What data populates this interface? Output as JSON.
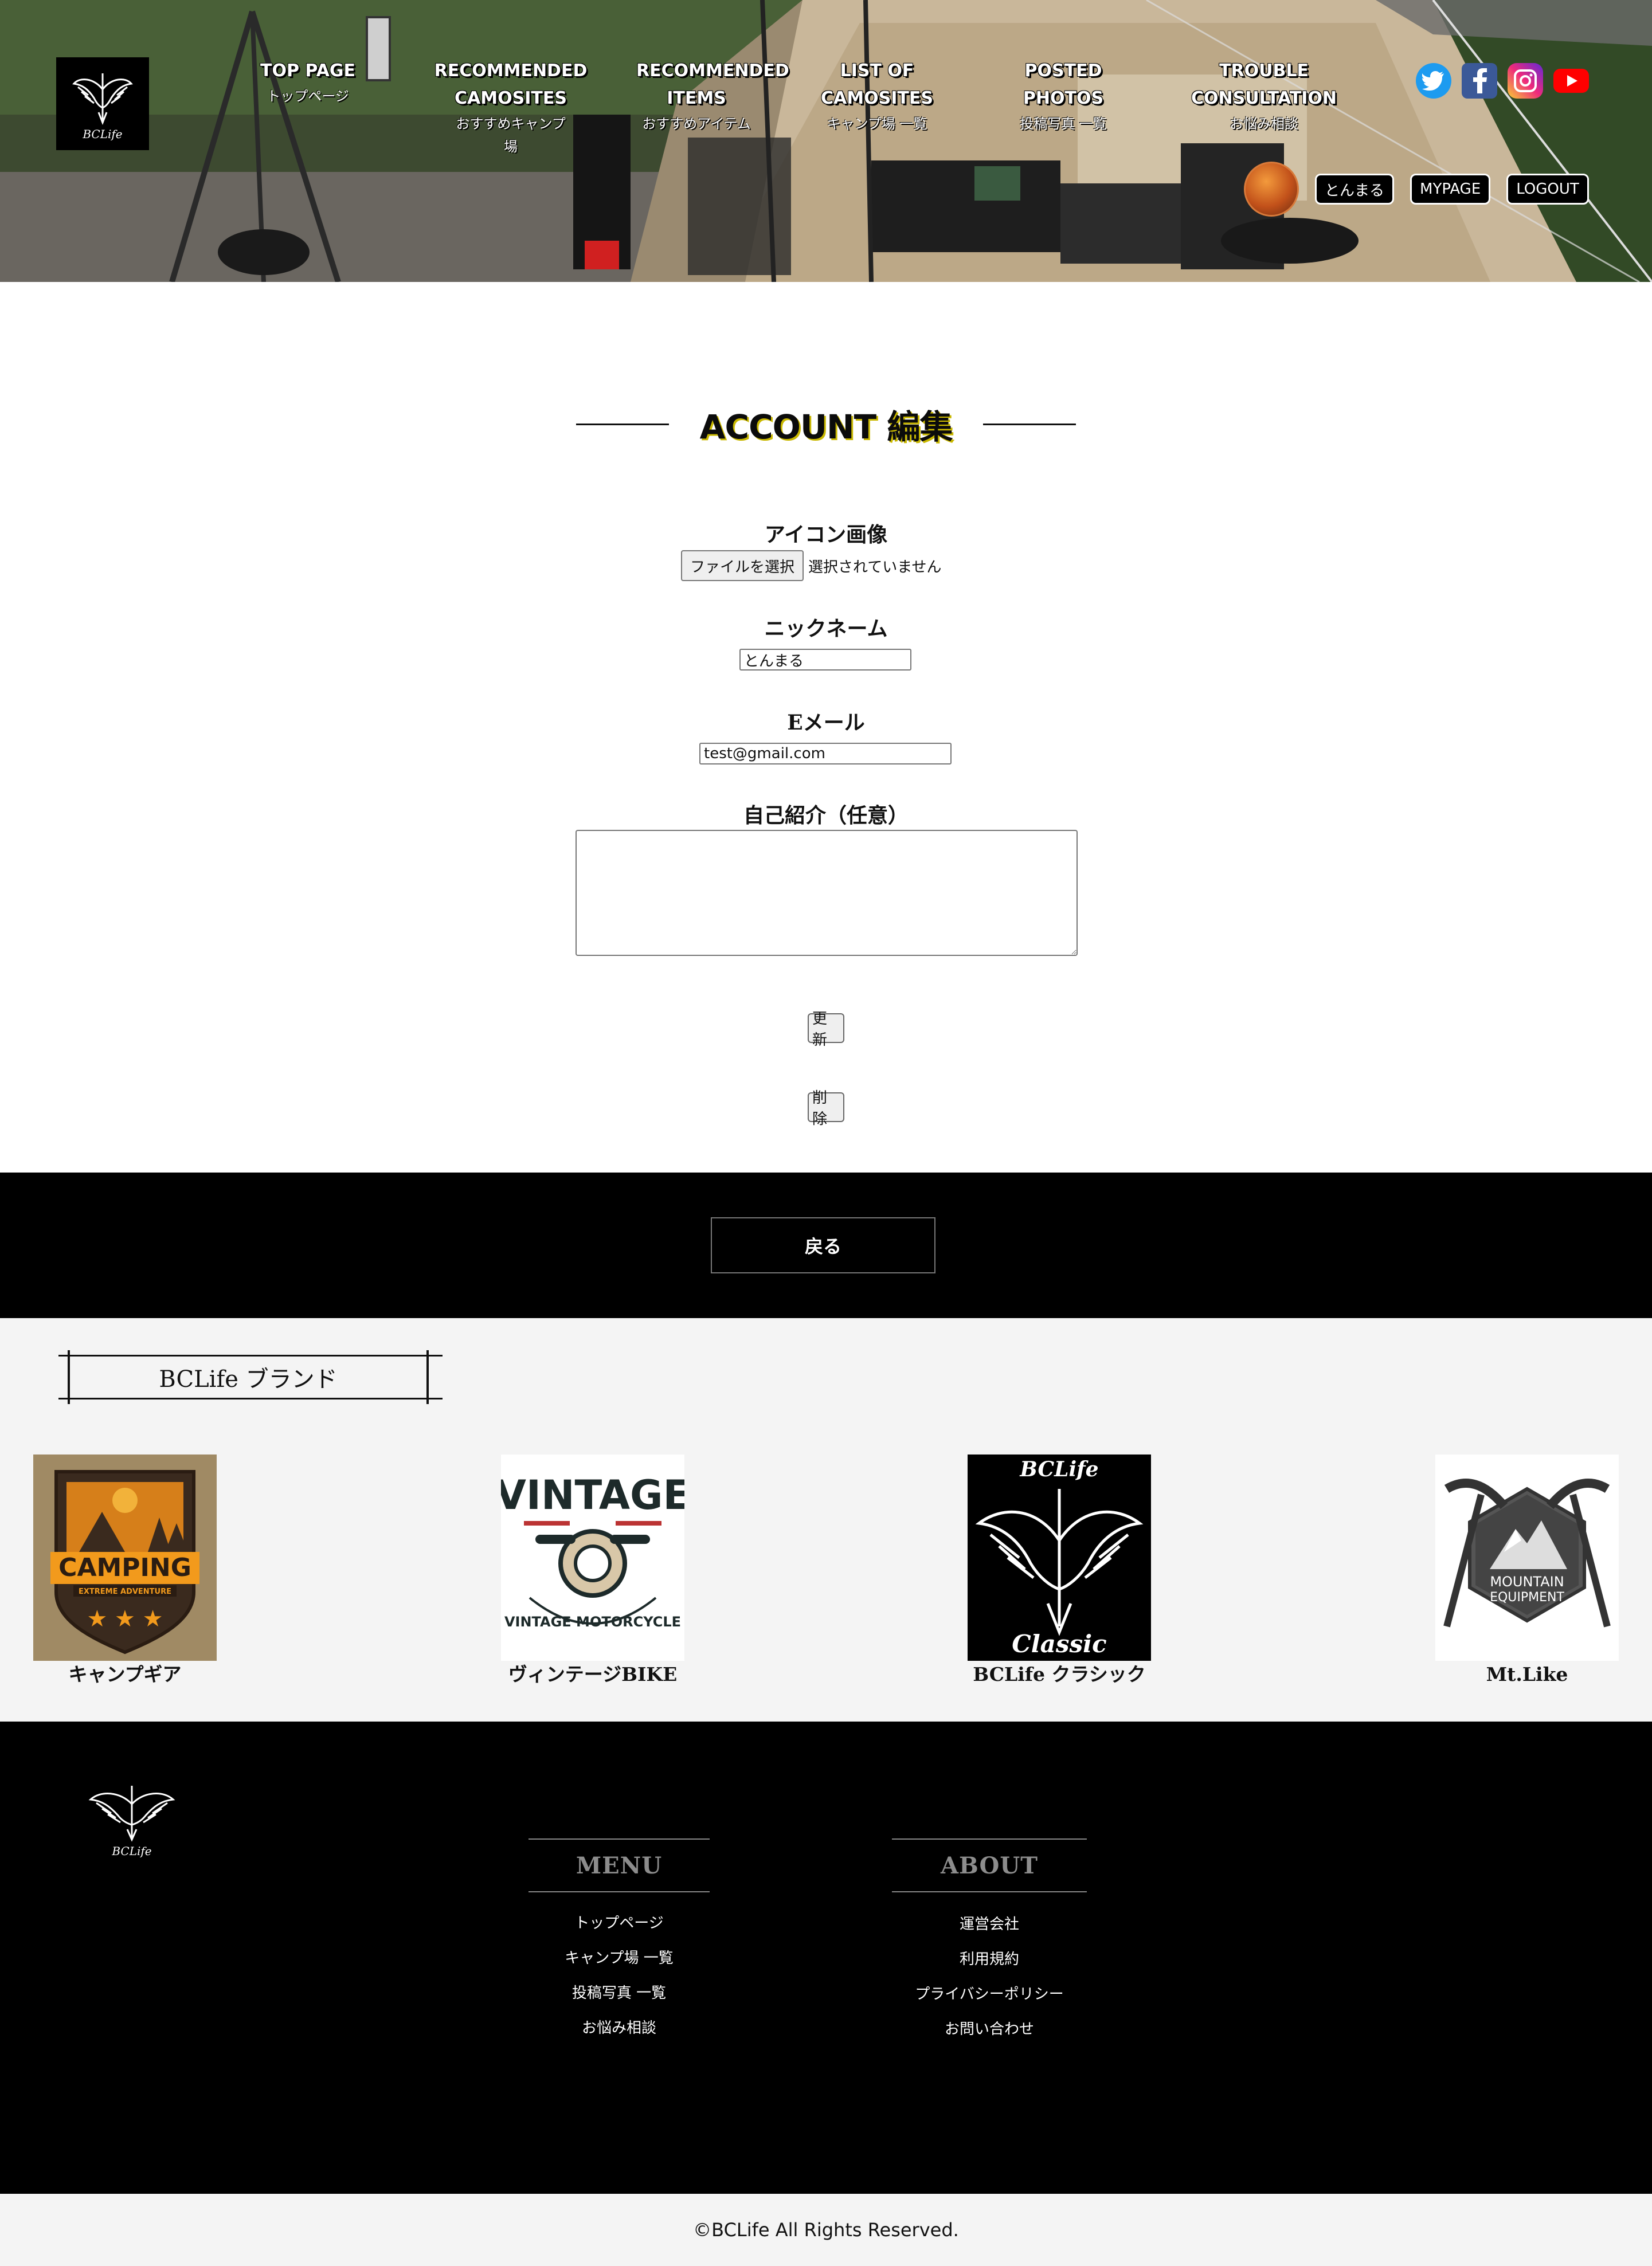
{
  "header": {
    "logo_text": "BCLife",
    "nav": [
      {
        "en": "TOP PAGE",
        "jp": "トップページ"
      },
      {
        "en": "RECOMMENDED CAMOSITES",
        "jp": "おすすめキャンプ場"
      },
      {
        "en": "RECOMMENDED ITEMS",
        "jp": "おすすめアイテム"
      },
      {
        "en": "LIST OF CAMOSITES",
        "jp": "キャンプ場 一覧"
      },
      {
        "en": "POSTED PHOTOS",
        "jp": "投稿写真 一覧"
      },
      {
        "en": "TROUBLE CONSULTATION",
        "jp": "お悩み相談"
      }
    ],
    "social": [
      "twitter-icon",
      "facebook-icon",
      "instagram-icon",
      "youtube-icon"
    ],
    "user": {
      "nickname_button": "とんまる",
      "mypage_button": "MYPAGE",
      "logout_button": "LOGOUT"
    }
  },
  "form": {
    "title": "ACCOUNT 編集",
    "icon_label": "アイコン画像",
    "file_button": "ファイルを選択",
    "file_status": "選択されていません",
    "nickname_label": "ニックネーム",
    "nickname_value": "とんまる",
    "email_label": "Eメール",
    "email_value": "test@gmail.com",
    "bio_label": "自己紹介（任意）",
    "bio_value": "",
    "update_button": "更新",
    "delete_button": "削除"
  },
  "back_button": "戻る",
  "brands": {
    "title": "BCLife ブランド",
    "items": [
      {
        "name": "キャンプギア",
        "logo_text": "CAMPING",
        "logo_sub": "EXTREME ADVENTURE"
      },
      {
        "name": "ヴィンテージBIKE",
        "logo_text": "VINTAGE",
        "logo_sub": "VINTAGE MOTORCYCLE"
      },
      {
        "name": "BCLife クラシック",
        "logo_text": "BCLife",
        "logo_sub": "Classic"
      },
      {
        "name": "Mt.Like",
        "logo_text": "MOUNTAIN",
        "logo_sub": "EQUIPMENT"
      }
    ]
  },
  "footer": {
    "logo_text": "BCLife",
    "menu": {
      "heading": "MENU",
      "links": [
        "トップページ",
        "キャンプ場 一覧",
        "投稿写真 一覧",
        "お悩み相談"
      ]
    },
    "about": {
      "heading": "ABOUT",
      "links": [
        "運営会社",
        "利用規約",
        "プライバシーポリシー",
        "お問い合わせ"
      ]
    },
    "copyright": "©BCLife All Rights Reserved."
  },
  "colors": {
    "title_shadow": "#c9b800",
    "footer_bg": "#000000",
    "brands_bg": "#f4f4f4",
    "twitter": "#1d9bf0",
    "facebook": "#3b5998",
    "youtube": "#ff0000"
  }
}
